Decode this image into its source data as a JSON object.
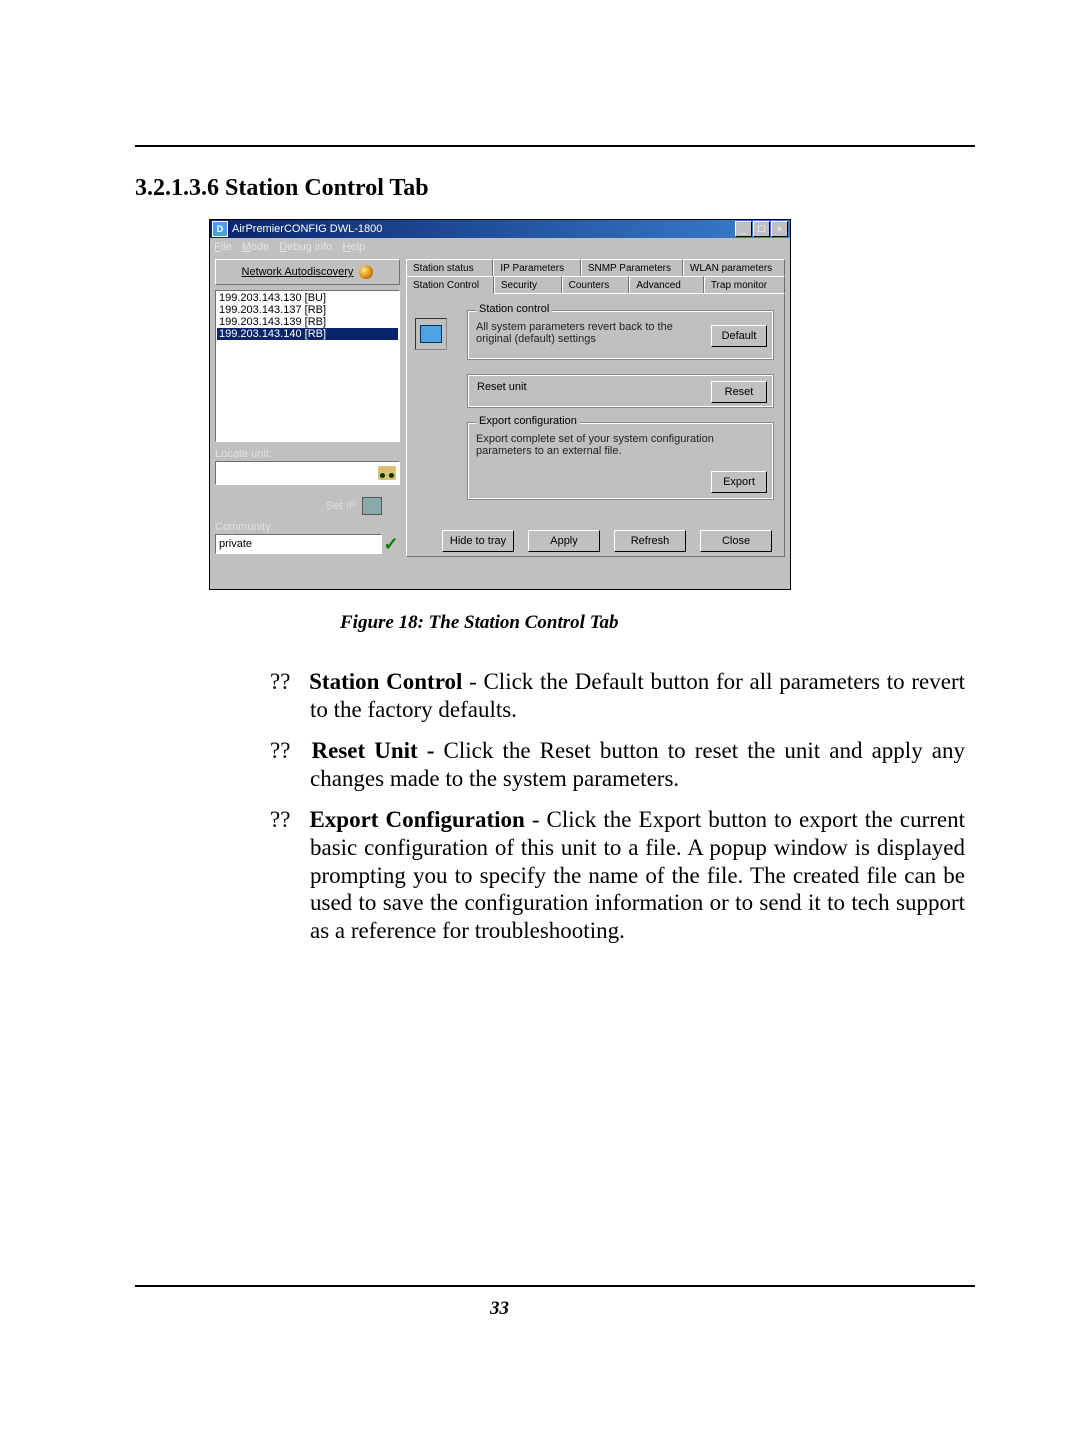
{
  "section_heading": "3.2.1.3.6  Station Control Tab",
  "figure_caption": "Figure 18: The Station Control Tab",
  "page_number": "33",
  "app_window": {
    "title": "AirPremierCONFIG DWL-1800",
    "menus": {
      "file": "File",
      "mode": "Mode",
      "debug": "Debug info",
      "help": "Help"
    },
    "left": {
      "na_button": "Network Autodiscovery",
      "ip_list": [
        "199.203.143.130  [BU]",
        "199.203.143.137  [RB]",
        "199.203.143.139  [RB]",
        "199.203.143.140  [RB]"
      ],
      "locate_label": "Locate unit:",
      "setip_label": "Set IP",
      "community_label": "Community:",
      "community_value": "private"
    },
    "tabs_row1": {
      "t1": "Station status",
      "t2": "IP Parameters",
      "t3": "SNMP Parameters",
      "t4": "WLAN parameters"
    },
    "tabs_row2": {
      "t1": "Station Control",
      "t2": "Security",
      "t3": "Counters",
      "t4": "Advanced",
      "t5": "Trap monitor"
    },
    "groups": {
      "g1_legend": "Station control",
      "g1_text": "All system parameters revert back to the original (default) settings",
      "g1_button": "Default",
      "g2_legend": "Reset unit",
      "g2_button": "Reset",
      "g3_legend": "Export configuration",
      "g3_text": "Export complete set of your system configuration parameters to an external file.",
      "g3_button": "Export"
    },
    "bottom_buttons": {
      "hide": "Hide to tray",
      "apply": "Apply",
      "refresh": "Refresh",
      "close": "Close"
    }
  },
  "bullets": {
    "b1_bold": "Station Control",
    "b1_rest": " - Click the Default  button for all parameters to revert to the factory defaults.",
    "b2_bold": "Reset Unit - ",
    "b2_rest": "Click the  Reset button to reset the unit and apply any changes made to the system parameters.",
    "b3_bold": "Export Configuration",
    "b3_rest": " - Click the  Export button to export the current basic configuration of this unit to a file. A popup window is displayed prompting you to specify the name of the file. The created file can be used to save the configuration information or to send it to tech support as a reference for troubleshooting."
  },
  "marker": "??"
}
